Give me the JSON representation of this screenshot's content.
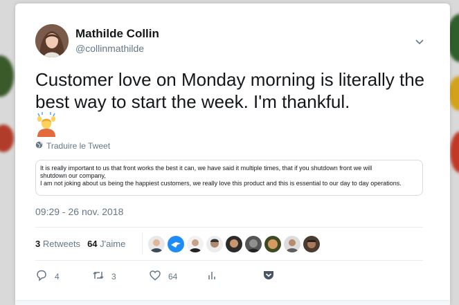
{
  "tweet": {
    "author_name": "Mathilde Collin",
    "author_handle": "@collinmathilde",
    "text": "Customer love on Monday morning is literally the best way to start the week. I'm thankful.",
    "translate_label": "Traduire le Tweet",
    "quote_lines": [
      "It is really important to us that front works the best it can, we have said it multiple times, that if you shutdown front we will",
      "shutdown our company,",
      "I am not joking about us being the happiest customers, we really love this product and this is essential to our day to day operations."
    ],
    "timestamp": "09:29 - 26 nov. 2018",
    "retweets_count": "3",
    "retweets_label": "Retweets",
    "likes_count": "64",
    "likes_label": "J'aime",
    "actions": {
      "reply_count": "4",
      "retweet_count": "3",
      "like_count": "64"
    }
  },
  "colors": {
    "text": "#14171a",
    "secondary": "#657786",
    "accent": "#1da1f2",
    "divider": "#e6ecf0"
  },
  "icons": {
    "chevron": "chevron-down-icon",
    "globe": "globe-icon",
    "reply": "reply-icon",
    "retweet": "retweet-icon",
    "like": "heart-icon",
    "analytics": "analytics-icon",
    "pocket": "pocket-icon",
    "emoji": "person-raising-hands-emoji"
  }
}
